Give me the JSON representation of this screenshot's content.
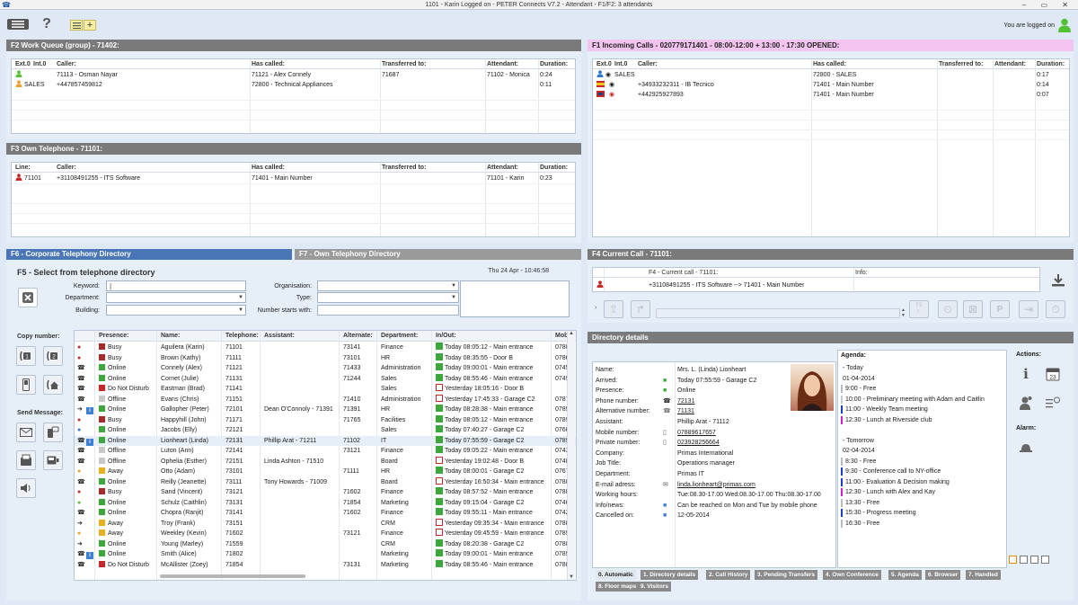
{
  "window": {
    "title": "1101 - Karin Logged on - PETER Connects V7.2 - Attendant  -  F1/F2: 3 attendants",
    "controls": "– ▭ ✕"
  },
  "toolbar": {
    "logged_on": "You are logged on"
  },
  "work_queue": {
    "title": "F2 Work Queue (group) - 71402:",
    "headers": [
      "Ext.0",
      "Int.0",
      "Caller:",
      "Has called:",
      "Transferred to:",
      "Attendant:",
      "Duration:"
    ],
    "rows": [
      {
        "icon": "person-icon",
        "ext": "",
        "caller": "71113 - Osman Nayar",
        "called": "71121 - Alex Connely",
        "transferred": "71687",
        "attendant": "71102 - Monica",
        "duration": "0:24"
      },
      {
        "icon": "person-icon",
        "ext": "SALES",
        "caller": "+447857459812",
        "called": "72800 - Technical Appliances",
        "transferred": "",
        "attendant": "",
        "duration": "0:11"
      }
    ]
  },
  "own_telephone": {
    "title": "F3 Own Telephone - 71101:",
    "headers": [
      "Line:",
      "Caller:",
      "Has called:",
      "Transferred to:",
      "Attendant:",
      "Duration:"
    ],
    "rows": [
      {
        "line": "71101",
        "caller": "+31108491255 - ITS Software",
        "called": "71401 - Main Number",
        "transferred": "",
        "attendant": "71101 - Karin",
        "duration": "0:23"
      }
    ]
  },
  "incoming": {
    "title": "F1 Incoming Calls - 020779171401  - 08:00-12:00 + 13:00 - 17:30 OPENED:",
    "headers": [
      "Ext.0",
      "Int.0",
      "Caller:",
      "Has called:",
      "Transferred to:",
      "Attendant:",
      "Duration:"
    ],
    "rows": [
      {
        "ext": "SALES",
        "caller": "",
        "called": "72800 - SALES",
        "duration": "0:17"
      },
      {
        "ext": "",
        "caller": "+34933232311 - IB Tecnico",
        "called": "71401 - Main Number",
        "duration": "0:14"
      },
      {
        "ext": "",
        "caller": "+442925927893",
        "called": "71401 - Main Number",
        "duration": "0:07"
      }
    ]
  },
  "directory": {
    "tab1": "F6 - Corporate Telephony Directory",
    "tab2": "F7 - Own Telephony Directory",
    "select_title": "F5 - Select from telephone directory",
    "datetime": "Thu 24 Apr - 10:46:58",
    "labels": {
      "keyword": "Keyword:",
      "department": "Department:",
      "building": "Building:",
      "organisation": "Organisation:",
      "type": "Type:",
      "number_starts": "Number starts with:"
    },
    "copy_number": "Copy number:",
    "send_message": "Send Message:",
    "headers": [
      "Presence:",
      "Name:",
      "Telephone:",
      "Assistant:",
      "Alternate:",
      "Department:",
      "In/Out:",
      "Mob"
    ],
    "rows": [
      {
        "mark": "person-red",
        "pc": "#a52a2a",
        "presence": "Busy",
        "name": "Aguilera (Karin)",
        "tel": "71101",
        "assistant": "",
        "alt": "73141",
        "dept": "Finance",
        "io": "in",
        "inout": "Today 08:05:12 - Main entrance",
        "mob": "0788"
      },
      {
        "mark": "person-red",
        "pc": "#a52a2a",
        "presence": "Busy",
        "name": "Brown (Kathy)",
        "tel": "71111",
        "assistant": "",
        "alt": "73101",
        "dept": "HR",
        "io": "in",
        "inout": "Today 08:35:55 - Door B",
        "mob": "0786"
      },
      {
        "mark": "phone",
        "pc": "#3ca83c",
        "presence": "Online",
        "name": "Connely (Alex)",
        "tel": "71121",
        "assistant": "",
        "alt": "71433",
        "dept": "Administration",
        "io": "in",
        "inout": "Today 09:00:01 - Main entrance",
        "mob": "0745"
      },
      {
        "mark": "phone",
        "pc": "#3ca83c",
        "presence": "Online",
        "name": "Cornet (Julie)",
        "tel": "71131",
        "assistant": "",
        "alt": "71244",
        "dept": "Sales",
        "io": "in",
        "inout": "Today 08:55:46 - Main entrance",
        "mob": "0749"
      },
      {
        "mark": "phone",
        "pc": "#c62828",
        "presence": "Do Not Disturb",
        "name": "Eastman (Brad)",
        "tel": "71141",
        "assistant": "",
        "alt": "",
        "dept": "Sales",
        "io": "out",
        "inout": "Yesterday 18:05:16 - Door B",
        "mob": ""
      },
      {
        "mark": "phone",
        "pc": "#c8c8c8",
        "presence": "Offline",
        "name": "Evans (Chris)",
        "tel": "71151",
        "assistant": "",
        "alt": "71410",
        "dept": "Administration",
        "io": "out",
        "inout": "Yesterday 17:45:33 - Garage C2",
        "mob": "0787"
      },
      {
        "mark": "arrow",
        "pc": "#3ca83c",
        "presence": "Online",
        "name": "Gallopher (Peter)",
        "tel": "72101",
        "assistant": "Dean O'Connoly - 71391",
        "alt": "71391",
        "dept": "HR",
        "io": "in",
        "inout": "Today 08:28:38 - Main entrance",
        "mob": "0789"
      },
      {
        "mark": "person-red",
        "pc": "#a52a2a",
        "presence": "Busy",
        "name": "Happyhill (John)",
        "tel": "71171",
        "assistant": "",
        "alt": "71765",
        "dept": "Facilities",
        "io": "in",
        "inout": "Today 08:05:12 - Main entrance",
        "mob": "0789"
      },
      {
        "mark": "person-blue",
        "pc": "#3ca83c",
        "presence": "Online",
        "name": "Jacobs (Elly)",
        "tel": "72121",
        "assistant": "",
        "alt": "",
        "dept": "Sales",
        "io": "in",
        "inout": "Today 07:40:27 - Garage C2",
        "mob": "0766"
      },
      {
        "mark": "phone",
        "pc": "#3ca83c",
        "presence": "Online",
        "name": "Lionheart (Linda)",
        "tel": "72131",
        "assistant": "Phillip Arat - 71211",
        "alt": "71102",
        "dept": "IT",
        "io": "in",
        "inout": "Today 07:55:59 - Garage C2",
        "mob": "0789"
      },
      {
        "mark": "phone",
        "pc": "#c8c8c8",
        "presence": "Offline",
        "name": "Luton (Ann)",
        "tel": "72141",
        "assistant": "",
        "alt": "73121",
        "dept": "Finance",
        "io": "in",
        "inout": "Today 09:05:22 - Main entrance",
        "mob": "0743"
      },
      {
        "mark": "phone",
        "pc": "#c8c8c8",
        "presence": "Offline",
        "name": "Ophelia (Esther)",
        "tel": "72151",
        "assistant": "Linda Ashton - 71510",
        "alt": "",
        "dept": "Board",
        "io": "out",
        "inout": "Yesterday 19:02:48 - Door B",
        "mob": "0748"
      },
      {
        "mark": "person-orange",
        "pc": "#e8b020",
        "presence": "Away",
        "name": "Otto (Adam)",
        "tel": "73101",
        "assistant": "",
        "alt": "71111",
        "dept": "HR",
        "io": "in",
        "inout": "Today 08:00:01 - Garage C2",
        "mob": "0767"
      },
      {
        "mark": "phone",
        "pc": "#3ca83c",
        "presence": "Online",
        "name": "Reilly (Jeanette)",
        "tel": "73111",
        "assistant": "Tony Howards - 71009",
        "alt": "",
        "dept": "Board",
        "io": "out",
        "inout": "Yesterday 16:50:34 - Main entrance",
        "mob": "0788"
      },
      {
        "mark": "person-red",
        "pc": "#a52a2a",
        "presence": "Busy",
        "name": "Sand (Vincent)",
        "tel": "73121",
        "assistant": "",
        "alt": "71602",
        "dept": "Finance",
        "io": "in",
        "inout": "Today 08:57:52 - Main entrance",
        "mob": "0788"
      },
      {
        "mark": "person-green",
        "pc": "#3ca83c",
        "presence": "Online",
        "name": "Schulz (Caithlin)",
        "tel": "73131",
        "assistant": "",
        "alt": "71854",
        "dept": "Marketing",
        "io": "in",
        "inout": "Today 09:15:04 - Garage C2",
        "mob": "0746"
      },
      {
        "mark": "phone",
        "pc": "#3ca83c",
        "presence": "Online",
        "name": "Chopra (Ranjit)",
        "tel": "73141",
        "assistant": "",
        "alt": "71602",
        "dept": "Finance",
        "io": "in",
        "inout": "Today 09:55:11 - Main entrance",
        "mob": "0742"
      },
      {
        "mark": "arrow",
        "pc": "#e8b020",
        "presence": "Away",
        "name": "Troy (Frank)",
        "tel": "73151",
        "assistant": "",
        "alt": "",
        "dept": "CRM",
        "io": "out",
        "inout": "Yesterday 09:35:34 - Main entrance",
        "mob": "0788"
      },
      {
        "mark": "person-orange",
        "pc": "#e8b020",
        "presence": "Away",
        "name": "Weekley (Kevin)",
        "tel": "71602",
        "assistant": "",
        "alt": "73121",
        "dept": "Finance",
        "io": "out",
        "inout": "Yesterday 09:45:59 - Main entrance",
        "mob": "0789"
      },
      {
        "mark": "arrow",
        "pc": "#3ca83c",
        "presence": "Online",
        "name": "Young (Marley)",
        "tel": "71559",
        "assistant": "",
        "alt": "",
        "dept": "CRM",
        "io": "in",
        "inout": "Today 08:20:38 - Garage C2",
        "mob": "0788"
      },
      {
        "mark": "phone",
        "pc": "#3ca83c",
        "presence": "Online",
        "name": "Smith (Alice)",
        "tel": "71802",
        "assistant": "",
        "alt": "",
        "dept": "Marketing",
        "io": "in",
        "inout": "Today 09:00:01 - Main entrance",
        "mob": "0789"
      },
      {
        "mark": "phone",
        "pc": "#c62828",
        "presence": "Do Not Disturb",
        "name": "McAllister (Zoey)",
        "tel": "71854",
        "assistant": "",
        "alt": "73131",
        "dept": "Marketing",
        "io": "in",
        "inout": "Today 08:55:46 - Main entrance",
        "mob": "0788"
      }
    ]
  },
  "current_call": {
    "title": "F4 Current Call - 71101:",
    "sub_title": "F4 - Current call - 71101:",
    "info_label": "Info:",
    "call_text": "+31108491255 - ITS Software --> 71401 - Main Number"
  },
  "details": {
    "title": "Directory details",
    "fields": [
      {
        "label": "Name:",
        "value": "Mrs. L. (Linda) Lionheart"
      },
      {
        "label": "Arrived:",
        "value": "Today 07:55:59 - Garage C2"
      },
      {
        "label": "Presence:",
        "value": "Online"
      },
      {
        "label": "Phone number:",
        "value": "72131"
      },
      {
        "label": "Alternative number:",
        "value": "71131"
      },
      {
        "label": "Assistant:",
        "value": "Phillip Arat - 71112"
      },
      {
        "label": "Mobile number:",
        "value": "07889617657"
      },
      {
        "label": "Private number:",
        "value": "023928256664"
      },
      {
        "label": "Company:",
        "value": "Primas International"
      },
      {
        "label": "Job Title:",
        "value": "Operations manager"
      },
      {
        "label": "Department:",
        "value": "Primas IT"
      },
      {
        "label": "E-mail adress:",
        "value": "linda.lionheart@primas.com"
      },
      {
        "label": "Working hours:",
        "value": "Tue:08.30-17.00 Wed:08.30-17.00 Thu:08.30-17.00"
      },
      {
        "label": "Info/news:",
        "value": "Can be reached on Mon and Tue by mobile phone"
      },
      {
        "label": "Cancelled on:",
        "value": "12-05-2014"
      }
    ],
    "agenda_label": "Agenda:",
    "agenda": [
      {
        "text": "- Today",
        "color": ""
      },
      {
        "text": "01-04-2014",
        "color": ""
      },
      {
        "text": "9:00 - Free",
        "color": "#ffffff"
      },
      {
        "text": "10:00 - Preliminary meeting with Adam and Caitlin",
        "color": "#c8c8c8"
      },
      {
        "text": "11:00 - Weekly Team meeting",
        "color": "#1a3fc8"
      },
      {
        "text": "12:30 - Lunch at Riverside club",
        "color": "#d020c8"
      },
      {
        "text": "",
        "color": ""
      },
      {
        "text": "- Tomorrow",
        "color": ""
      },
      {
        "text": "02-04-2014",
        "color": ""
      },
      {
        "text": "8:30 - Free",
        "color": "#ffffff"
      },
      {
        "text": "9:30 - Conference call to NY-office",
        "color": "#1a3fc8"
      },
      {
        "text": "11:00 - Evaluation & Decision making",
        "color": "#1a3fc8"
      },
      {
        "text": "12:30 - Lunch with Alex and Kay",
        "color": "#d020c8"
      },
      {
        "text": "13:30 - Free",
        "color": "#ffffff"
      },
      {
        "text": "15:30 - Progress meeting",
        "color": "#1a3fc8"
      },
      {
        "text": "16:30 - Free",
        "color": "#ffffff"
      }
    ],
    "actions_label": "Actions:",
    "alarm_label": "Alarm:",
    "tabs": [
      "0. Automatic",
      "1. Directory details",
      "2. Call History",
      "3. Pending Transfers",
      "4. Own Conference",
      "5. Agenda",
      "6. Browser",
      "7. Handled",
      "8. Floor maps",
      "9. Visitors"
    ]
  }
}
